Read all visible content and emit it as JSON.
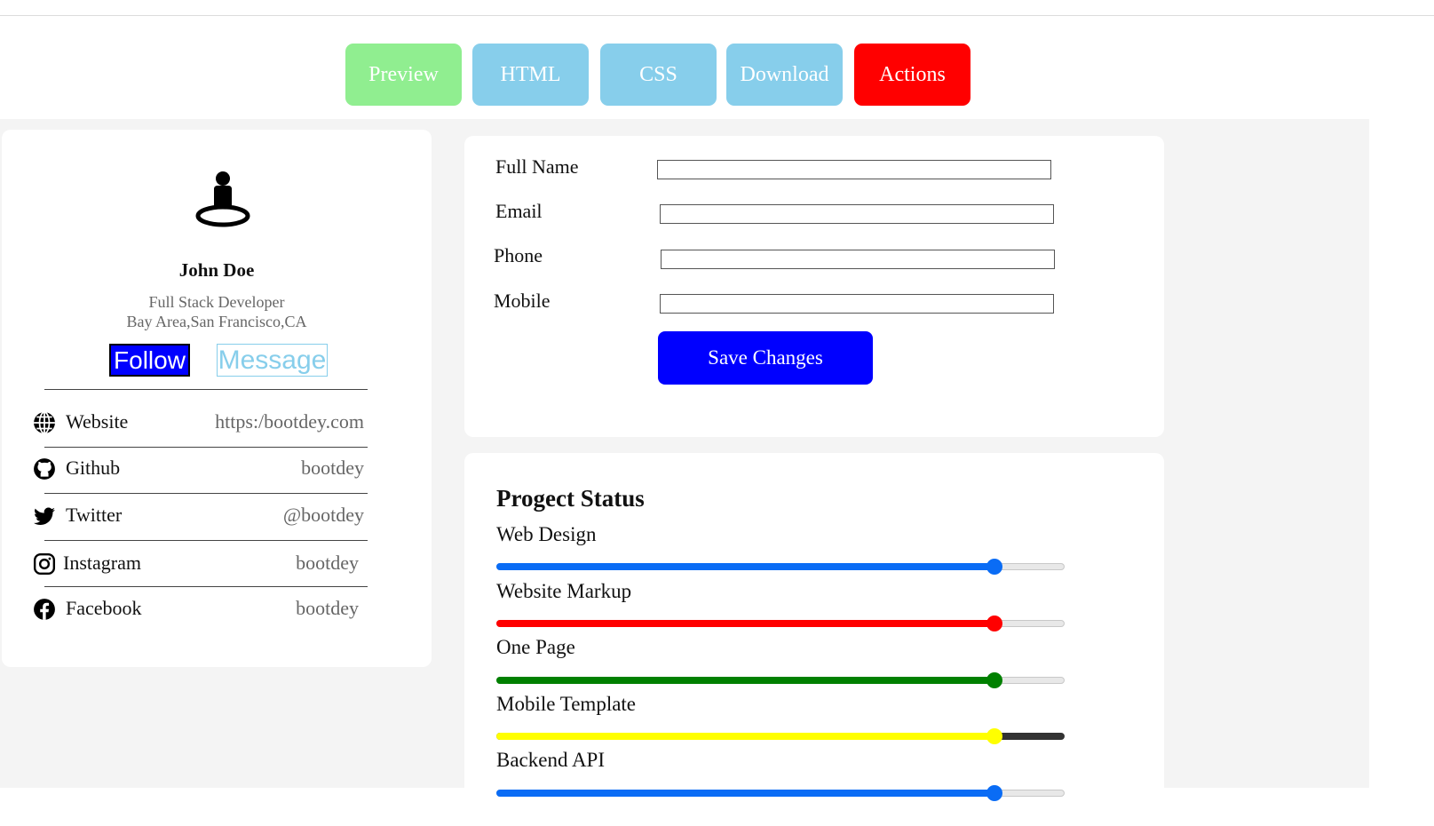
{
  "tabs": [
    {
      "label": "Preview",
      "color": "#90ee90"
    },
    {
      "label": "HTML",
      "color": "#87ceeb"
    },
    {
      "label": "CSS",
      "color": "#87ceeb"
    },
    {
      "label": "Download",
      "color": "#87ceeb"
    },
    {
      "label": "Actions",
      "color": "#ff0000"
    }
  ],
  "profile": {
    "name": "John Doe",
    "role": "Full Stack Developer",
    "location": "Bay Area,San Francisco,CA",
    "follow_label": "Follow",
    "message_label": "Message",
    "avatar_icon": "person-pin-icon",
    "social": [
      {
        "icon": "globe-icon",
        "label": "Website",
        "value": "https:/bootdey.com"
      },
      {
        "icon": "github-icon",
        "label": "Github",
        "value": "bootdey"
      },
      {
        "icon": "twitter-icon",
        "label": "Twitter",
        "value": "@bootdey"
      },
      {
        "icon": "instagram-icon",
        "label": "Instagram",
        "value": "bootdey"
      },
      {
        "icon": "facebook-icon",
        "label": "Facebook",
        "value": "bootdey"
      }
    ]
  },
  "form": {
    "fields": [
      {
        "label": "Full Name",
        "value": ""
      },
      {
        "label": "Email",
        "value": ""
      },
      {
        "label": "Phone",
        "value": ""
      },
      {
        "label": "Mobile",
        "value": ""
      }
    ],
    "save_label": "Save Changes"
  },
  "status": {
    "title": "Progect Status",
    "items": [
      {
        "label": "Web Design",
        "percent": 88,
        "color": "#0a6cf5"
      },
      {
        "label": "Website Markup",
        "percent": 88,
        "color": "#ff0000"
      },
      {
        "label": "One Page",
        "percent": 88,
        "color": "#008000"
      },
      {
        "label": "Mobile Template",
        "percent": 88,
        "color": "#ffff00",
        "track_color": "#333333"
      },
      {
        "label": "Backend API",
        "percent": 88,
        "color": "#0a6cf5"
      }
    ]
  }
}
